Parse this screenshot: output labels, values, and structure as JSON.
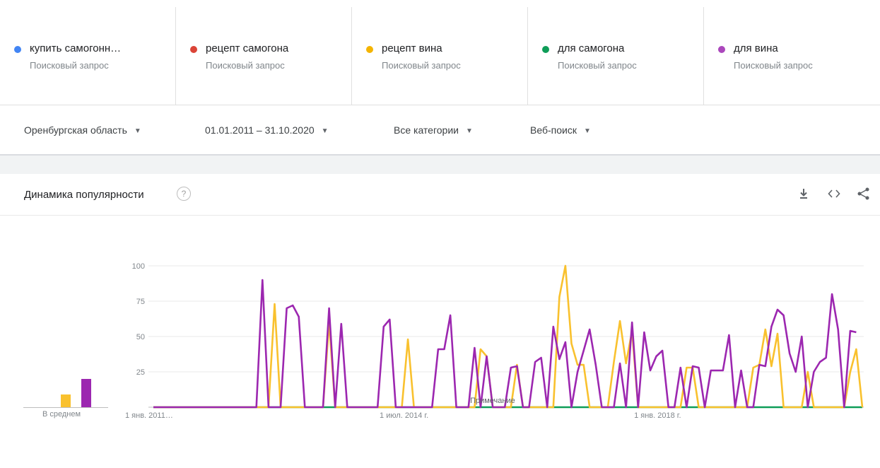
{
  "terms": [
    {
      "name": "купить самогонн…",
      "sub": "Поисковый запрос",
      "color": "#4285f4"
    },
    {
      "name": "рецепт самогона",
      "sub": "Поисковый запрос",
      "color": "#db4437"
    },
    {
      "name": "рецепт вина",
      "sub": "Поисковый запрос",
      "color": "#f4b400"
    },
    {
      "name": "для самогона",
      "sub": "Поисковый запрос",
      "color": "#0f9d58"
    },
    {
      "name": "для вина",
      "sub": "Поисковый запрос",
      "color": "#ab47bc"
    }
  ],
  "filters": {
    "region": "Оренбургская область",
    "dates": "01.01.2011 – 31.10.2020",
    "category": "Все категории",
    "search_type": "Веб-поиск"
  },
  "card": {
    "title": "Динамика популярности",
    "help_icon": "help-circle-icon",
    "icons": [
      "download-icon",
      "embed-icon",
      "share-icon"
    ]
  },
  "average": {
    "label": "В среднем",
    "values": [
      {
        "name": "рецепт вина",
        "value": 9,
        "color": "#f9c12e"
      },
      {
        "name": "для вина",
        "value": 20,
        "color": "#9c27b0"
      }
    ]
  },
  "chart_data": {
    "type": "line",
    "y_ticks": [
      "100",
      "75",
      "50",
      "25"
    ],
    "ylim": [
      0,
      100
    ],
    "grid": true,
    "x_range": [
      "2011-01",
      "2020-10"
    ],
    "x_tick_labels": [
      {
        "label": "1 янв. 2011…",
        "date": "2011-01"
      },
      {
        "label": "1 июл. 2014 г.",
        "date": "2014-07"
      },
      {
        "label": "1 янв. 2018 г.",
        "date": "2018-01"
      }
    ],
    "annotation": {
      "text": "Примечание",
      "date": "2015-09"
    },
    "series": [
      {
        "name": "для самогона",
        "color": "#0f9d58",
        "points": [
          [
            "2011-01",
            0
          ],
          [
            "2020-10",
            0
          ]
        ]
      },
      {
        "name": "рецепт вина",
        "color": "#f9c12e",
        "points": [
          [
            "2011-01",
            0
          ],
          [
            "2012-08",
            0
          ],
          [
            "2012-09",
            73
          ],
          [
            "2012-10",
            0
          ],
          [
            "2013-01",
            0
          ],
          [
            "2013-05",
            0
          ],
          [
            "2013-06",
            60
          ],
          [
            "2013-07",
            0
          ],
          [
            "2014-06",
            0
          ],
          [
            "2014-07",
            48
          ],
          [
            "2014-08",
            0
          ],
          [
            "2015-01",
            0
          ],
          [
            "2015-06",
            0
          ],
          [
            "2015-07",
            41
          ],
          [
            "2015-08",
            36
          ],
          [
            "2015-09",
            0
          ],
          [
            "2015-12",
            0
          ],
          [
            "2016-01",
            30
          ],
          [
            "2016-02",
            0
          ],
          [
            "2016-07",
            0
          ],
          [
            "2016-08",
            78
          ],
          [
            "2016-09",
            100
          ],
          [
            "2016-10",
            45
          ],
          [
            "2016-11",
            30
          ],
          [
            "2016-12",
            30
          ],
          [
            "2017-01",
            0
          ],
          [
            "2017-04",
            0
          ],
          [
            "2017-05",
            32
          ],
          [
            "2017-06",
            61
          ],
          [
            "2017-07",
            31
          ],
          [
            "2017-08",
            54
          ],
          [
            "2017-09",
            0
          ],
          [
            "2018-04",
            0
          ],
          [
            "2018-05",
            28
          ],
          [
            "2018-06",
            28
          ],
          [
            "2018-07",
            0
          ],
          [
            "2019-03",
            0
          ],
          [
            "2019-04",
            28
          ],
          [
            "2019-05",
            30
          ],
          [
            "2019-06",
            55
          ],
          [
            "2019-07",
            29
          ],
          [
            "2019-08",
            52
          ],
          [
            "2019-09",
            0
          ],
          [
            "2019-12",
            0
          ],
          [
            "2020-01",
            25
          ],
          [
            "2020-02",
            0
          ],
          [
            "2020-07",
            0
          ],
          [
            "2020-08",
            25
          ],
          [
            "2020-09",
            41
          ],
          [
            "2020-10",
            0
          ]
        ]
      },
      {
        "name": "для вина",
        "color": "#9c27b0",
        "points": [
          [
            "2011-01",
            0
          ],
          [
            "2012-06",
            0
          ],
          [
            "2012-07",
            90
          ],
          [
            "2012-08",
            0
          ],
          [
            "2012-10",
            0
          ],
          [
            "2012-11",
            70
          ],
          [
            "2012-12",
            72
          ],
          [
            "2013-01",
            64
          ],
          [
            "2013-02",
            0
          ],
          [
            "2013-05",
            0
          ],
          [
            "2013-06",
            70
          ],
          [
            "2013-07",
            0
          ],
          [
            "2013-08",
            59
          ],
          [
            "2013-09",
            0
          ],
          [
            "2014-02",
            0
          ],
          [
            "2014-03",
            57
          ],
          [
            "2014-04",
            62
          ],
          [
            "2014-05",
            0
          ],
          [
            "2014-11",
            0
          ],
          [
            "2014-12",
            41
          ],
          [
            "2015-01",
            41
          ],
          [
            "2015-02",
            65
          ],
          [
            "2015-03",
            0
          ],
          [
            "2015-05",
            0
          ],
          [
            "2015-06",
            42
          ],
          [
            "2015-07",
            0
          ],
          [
            "2015-08",
            36
          ],
          [
            "2015-09",
            0
          ],
          [
            "2015-11",
            0
          ],
          [
            "2015-12",
            28
          ],
          [
            "2016-01",
            29
          ],
          [
            "2016-02",
            0
          ],
          [
            "2016-03",
            0
          ],
          [
            "2016-04",
            32
          ],
          [
            "2016-05",
            35
          ],
          [
            "2016-06",
            0
          ],
          [
            "2016-07",
            57
          ],
          [
            "2016-08",
            34
          ],
          [
            "2016-09",
            46
          ],
          [
            "2016-10",
            0
          ],
          [
            "2016-11",
            25
          ],
          [
            "2016-12",
            40
          ],
          [
            "2017-01",
            55
          ],
          [
            "2017-02",
            30
          ],
          [
            "2017-03",
            0
          ],
          [
            "2017-05",
            0
          ],
          [
            "2017-06",
            31
          ],
          [
            "2017-07",
            0
          ],
          [
            "2017-08",
            60
          ],
          [
            "2017-09",
            0
          ],
          [
            "2017-10",
            53
          ],
          [
            "2017-11",
            26
          ],
          [
            "2017-12",
            36
          ],
          [
            "2018-01",
            40
          ],
          [
            "2018-02",
            0
          ],
          [
            "2018-03",
            0
          ],
          [
            "2018-04",
            28
          ],
          [
            "2018-05",
            0
          ],
          [
            "2018-06",
            29
          ],
          [
            "2018-07",
            28
          ],
          [
            "2018-08",
            0
          ],
          [
            "2018-09",
            26
          ],
          [
            "2018-10",
            26
          ],
          [
            "2018-11",
            26
          ],
          [
            "2018-12",
            51
          ],
          [
            "2019-01",
            0
          ],
          [
            "2019-02",
            26
          ],
          [
            "2019-03",
            0
          ],
          [
            "2019-04",
            0
          ],
          [
            "2019-05",
            30
          ],
          [
            "2019-06",
            29
          ],
          [
            "2019-07",
            57
          ],
          [
            "2019-08",
            69
          ],
          [
            "2019-09",
            65
          ],
          [
            "2019-10",
            38
          ],
          [
            "2019-11",
            25
          ],
          [
            "2019-12",
            50
          ],
          [
            "2020-01",
            0
          ],
          [
            "2020-02",
            25
          ],
          [
            "2020-03",
            32
          ],
          [
            "2020-04",
            35
          ],
          [
            "2020-05",
            80
          ],
          [
            "2020-06",
            55
          ],
          [
            "2020-07",
            0
          ],
          [
            "2020-08",
            54
          ],
          [
            "2020-09",
            53
          ]
        ]
      }
    ]
  }
}
